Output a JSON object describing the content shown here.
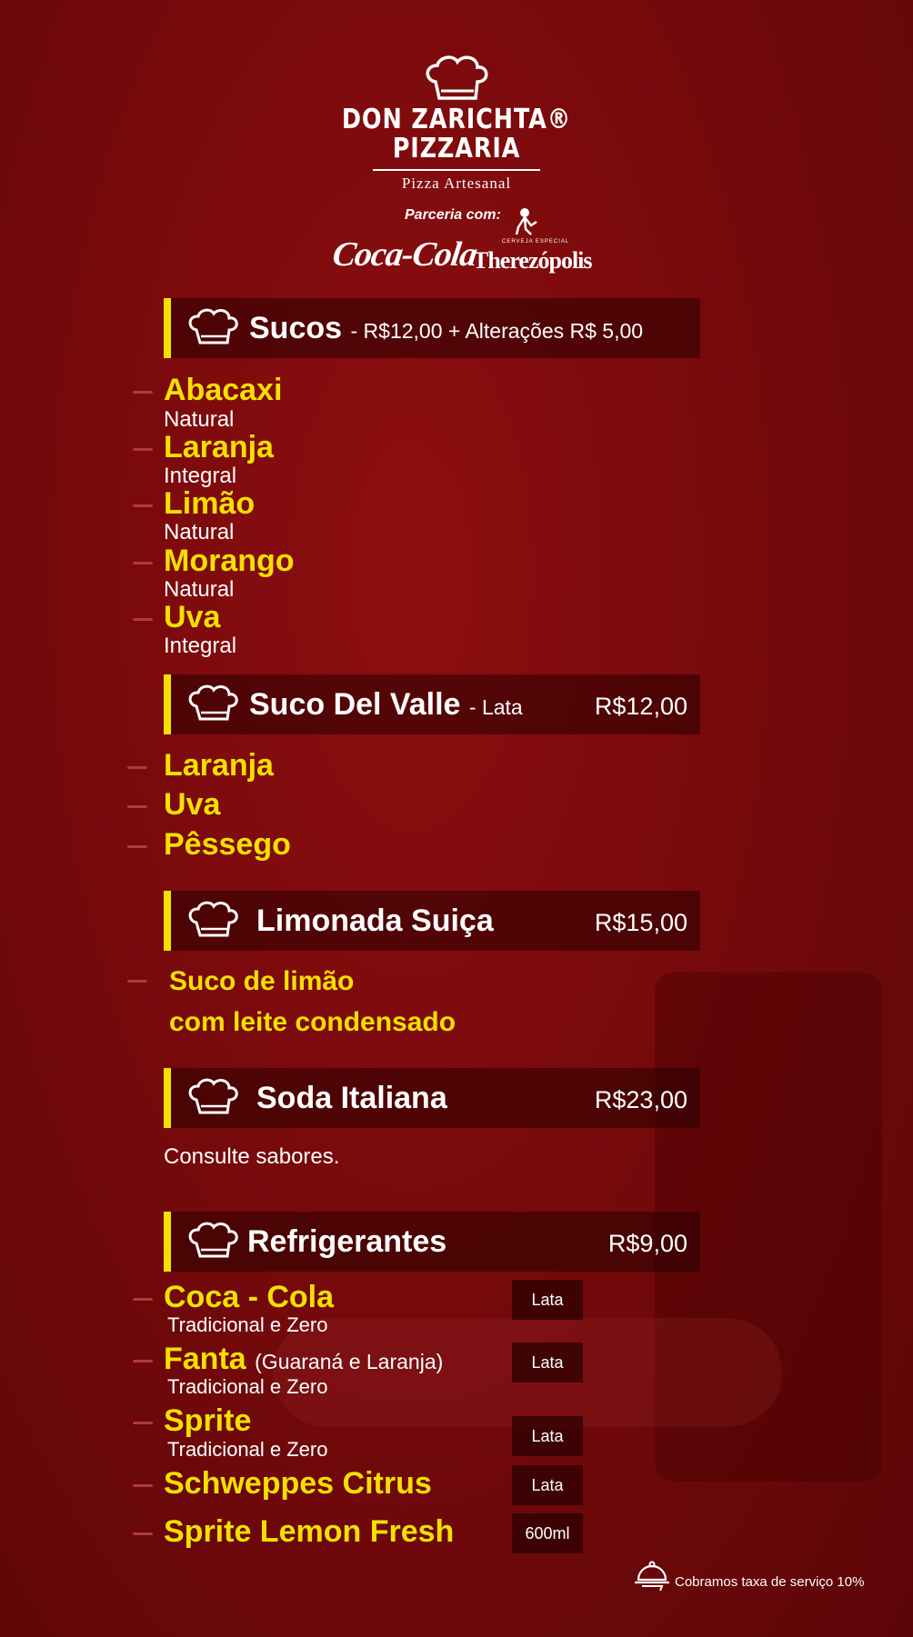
{
  "brand": {
    "line1": "DON ZARICHTA®",
    "line2": "PIZZARIA",
    "tagline": "Pizza Artesanal",
    "partner_label": "Parceria com:",
    "coke": "Coca-Cola",
    "beer": "Therezópolis",
    "beer_sub": "CERVEJA ESPECIAL"
  },
  "sections": [
    {
      "title": "Sucos",
      "subtitle": "- R$12,00 + Alterações R$ 5,00",
      "price": "",
      "items": [
        {
          "name": "Abacaxi",
          "desc": "Natural"
        },
        {
          "name": "Laranja",
          "desc": "Integral"
        },
        {
          "name": "Limão",
          "desc": "Natural"
        },
        {
          "name": "Morango",
          "desc": "Natural"
        },
        {
          "name": "Uva",
          "desc": "Integral"
        }
      ]
    },
    {
      "title": "Suco Del Valle",
      "subtitle": "- Lata",
      "price": "R$12,00",
      "items": [
        {
          "name": "Laranja"
        },
        {
          "name": "Uva"
        },
        {
          "name": "Pêssego"
        }
      ]
    },
    {
      "title": "Limonada Suiça",
      "price": "R$15,00",
      "items": [
        {
          "name": "Suco de limão"
        },
        {
          "name": "com leite condensado"
        }
      ]
    },
    {
      "title": "Soda Italiana",
      "price": "R$23,00",
      "note": "Consulte sabores."
    },
    {
      "title": "Refrigerantes",
      "price": "R$9,00",
      "items": [
        {
          "name": "Coca - Cola",
          "desc": "Tradicional e Zero",
          "tag": "Lata"
        },
        {
          "name": "Fanta",
          "extra": "(Guaraná e Laranja)",
          "desc": "Tradicional e Zero",
          "tag": "Lata"
        },
        {
          "name": "Sprite",
          "desc": "Tradicional e Zero",
          "tag": "Lata"
        },
        {
          "name": "Schweppes Citrus",
          "tag": "Lata"
        },
        {
          "name": "Sprite Lemon Fresh",
          "tag": "600ml"
        }
      ]
    }
  ],
  "footer": {
    "service_fee": "Cobramos taxa de serviço 10%"
  },
  "colors": {
    "accent": "#f5e000",
    "background": "#7a0a0c"
  }
}
